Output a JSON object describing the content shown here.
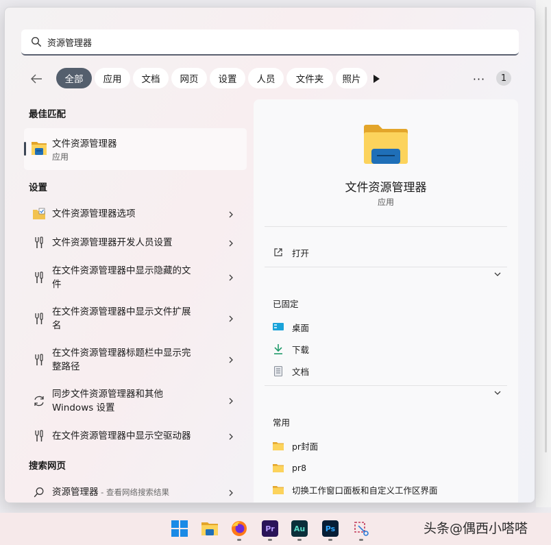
{
  "search": {
    "value": "资源管理器"
  },
  "filters": {
    "chips": [
      "全部",
      "应用",
      "文档",
      "网页",
      "设置",
      "人员",
      "文件夹",
      "照片"
    ],
    "active": "全部",
    "badge": "1"
  },
  "best_match": {
    "heading": "最佳匹配",
    "name": "文件资源管理器",
    "type": "应用"
  },
  "settings": {
    "heading": "设置",
    "items": [
      [
        "文件资源管理器选项"
      ],
      [
        "文件资源管理器开发人员设置"
      ],
      [
        "在文件资源管理器中显示隐藏的文",
        "件"
      ],
      [
        "在文件资源管理器中显示文件扩展",
        "名"
      ],
      [
        "在文件资源管理器标题栏中显示完",
        "整路径"
      ],
      [
        "同步文件资源管理器和其他",
        "Windows 设置"
      ],
      [
        "在文件资源管理器中显示空驱动器"
      ]
    ]
  },
  "web": {
    "heading": "搜索网页",
    "query": "资源管理器",
    "hint": " - 查看网络搜索结果"
  },
  "details": {
    "title": "文件资源管理器",
    "subtitle": "应用",
    "open": "打开",
    "pinned_heading": "已固定",
    "pinned": [
      "桌面",
      "下载",
      "文档"
    ],
    "frequent_heading": "常用",
    "frequent": [
      "pr封面",
      "pr8",
      "切换工作窗口面板和自定义工作区界面"
    ]
  },
  "taskbar": {
    "apps": [
      "Pr",
      "Au",
      "Ps"
    ]
  },
  "watermark": "头条@偶西小嗒嗒"
}
